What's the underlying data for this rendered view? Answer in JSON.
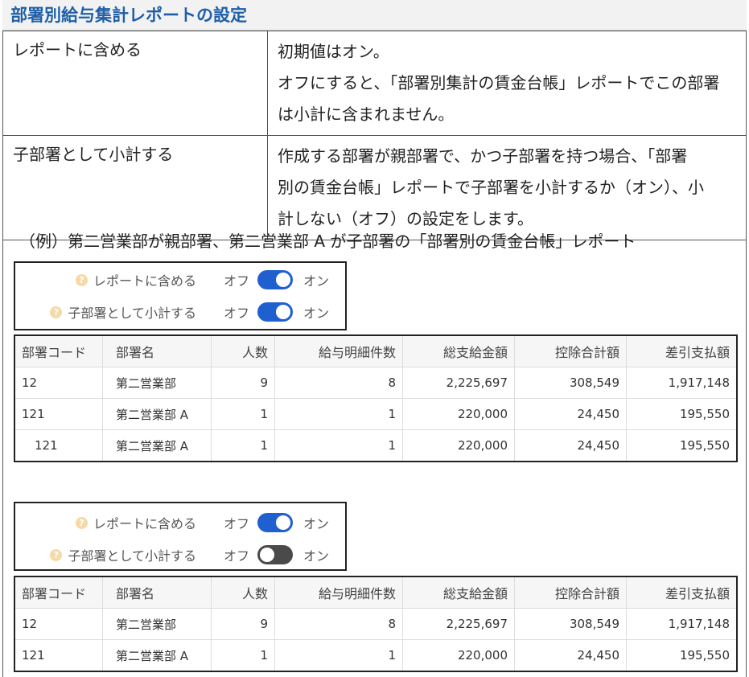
{
  "heading": "部署別給与集計レポートの設定",
  "settings": [
    {
      "label": "レポートに含める",
      "lines": [
        "初期値はオン。",
        "オフにすると、「部署別集計の賃金台帳」レポートでこの部署",
        "は小計に含まれません。"
      ]
    },
    {
      "label": "子部署として小計する",
      "lines": [
        "作成する部署が親部署で、かつ子部署を持つ場合、「部署",
        "別の賃金台帳」レポートで子部署を小計するか（オン）、小",
        "計しない（オフ）の設定をします。"
      ]
    }
  ],
  "example_caption": "（例）第二営業部が親部署、第二営業部 A が子部署の「部署別の賃金台帳」レポート",
  "toggle_text": {
    "include": "レポートに含める",
    "subtotal": "子部署として小計する",
    "off": "オフ",
    "on": "オン",
    "help": "?"
  },
  "example1": {
    "include": "on",
    "subtotal": "on"
  },
  "example2": {
    "include": "on",
    "subtotal": "off"
  },
  "columns": [
    "部署コード",
    "部署名",
    "人数",
    "給与明細件数",
    "総支給金額",
    "控除合計額",
    "差引支払額"
  ],
  "table1": [
    [
      "12",
      "第二営業部",
      "9",
      "8",
      "2,225,697",
      "308,549",
      "1,917,148"
    ],
    [
      "121",
      "第二営業部 A",
      "1",
      "1",
      "220,000",
      "24,450",
      "195,550"
    ],
    [
      "121",
      "第二営業部 A",
      "1",
      "1",
      "220,000",
      "24,450",
      "195,550"
    ]
  ],
  "table2": [
    [
      "12",
      "第二営業部",
      "9",
      "8",
      "2,225,697",
      "308,549",
      "1,917,148"
    ],
    [
      "121",
      "第二営業部 A",
      "1",
      "1",
      "220,000",
      "24,450",
      "195,550"
    ]
  ],
  "colors": {
    "heading": "#1f5fa8",
    "switch_on": "#1f5fd0",
    "switch_off": "#4a4a4a",
    "help_icon": "#f5d9a8"
  }
}
